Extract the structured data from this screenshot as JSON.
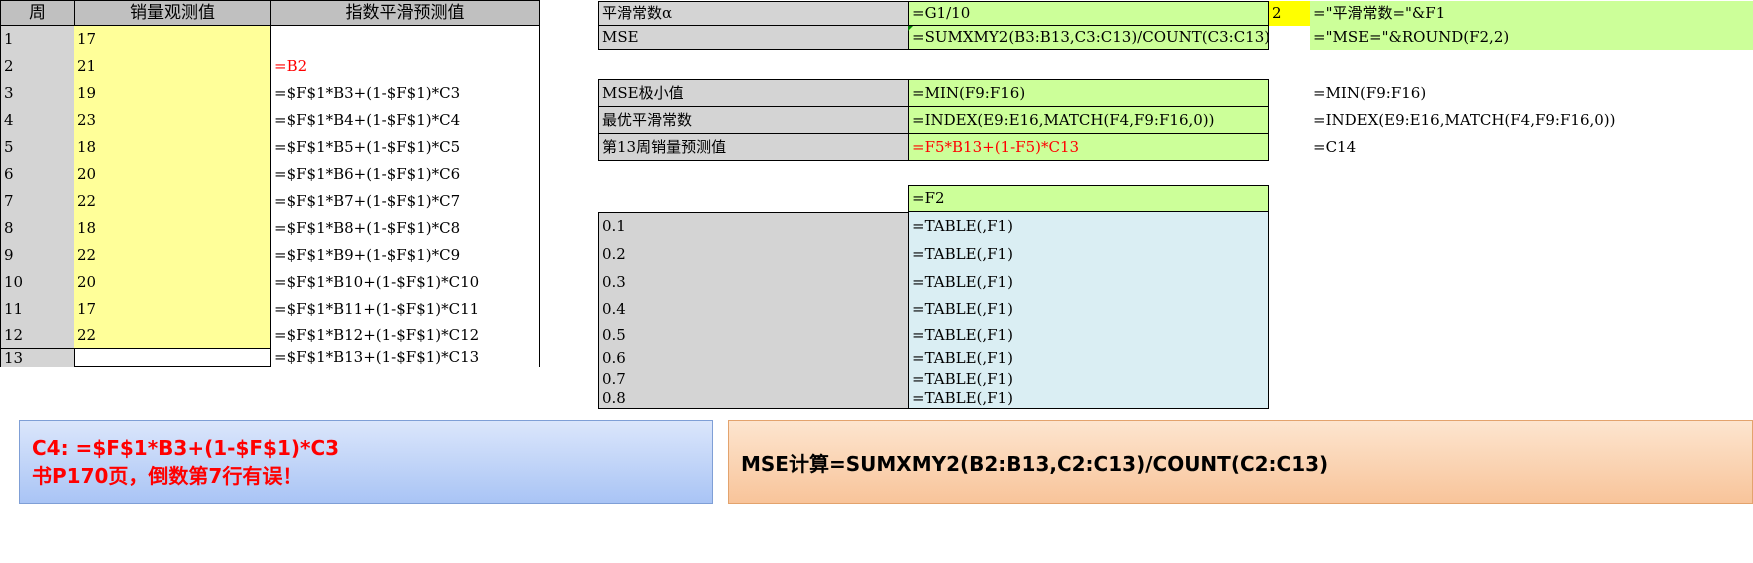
{
  "headers": {
    "week": "周",
    "observed": "销量观测值",
    "forecast": "指数平滑预测值"
  },
  "rows": [
    {
      "week": "1",
      "obs": "17",
      "fc": ""
    },
    {
      "week": "2",
      "obs": "21",
      "fc": "=B2"
    },
    {
      "week": "3",
      "obs": "19",
      "fc": "=$F$1*B3+(1-$F$1)*C3"
    },
    {
      "week": "4",
      "obs": "23",
      "fc": "=$F$1*B4+(1-$F$1)*C4"
    },
    {
      "week": "5",
      "obs": "18",
      "fc": "=$F$1*B5+(1-$F$1)*C5"
    },
    {
      "week": "6",
      "obs": "20",
      "fc": "=$F$1*B6+(1-$F$1)*C6"
    },
    {
      "week": "7",
      "obs": "22",
      "fc": "=$F$1*B7+(1-$F$1)*C7"
    },
    {
      "week": "8",
      "obs": "18",
      "fc": "=$F$1*B8+(1-$F$1)*C8"
    },
    {
      "week": "9",
      "obs": "22",
      "fc": "=$F$1*B9+(1-$F$1)*C9"
    },
    {
      "week": "10",
      "obs": "20",
      "fc": "=$F$1*B10+(1-$F$1)*C10"
    },
    {
      "week": "11",
      "obs": "17",
      "fc": "=$F$1*B11+(1-$F$1)*C11"
    },
    {
      "week": "12",
      "obs": "22",
      "fc": "=$F$1*B12+(1-$F$1)*C12"
    },
    {
      "week": "13",
      "obs": "",
      "fc": "=$F$1*B13+(1-$F$1)*C13"
    }
  ],
  "params": {
    "alpha_label": "平滑常数α",
    "alpha_formula": "=G1/10",
    "spinner_value": "2",
    "alpha_text": "=\"平滑常数=\"&F1",
    "mse_label": "MSE",
    "mse_formula": "=SUMXMY2(B3:B13,C3:C13)/COUNT(C3:C13)",
    "mse_text": "=\"MSE=\"&ROUND(F2,2)"
  },
  "results": [
    {
      "label": "MSE极小值",
      "formula": "=MIN(F9:F16)",
      "note": "=MIN(F9:F16)"
    },
    {
      "label": "最优平滑常数",
      "formula": "=INDEX(E9:E16,MATCH(F4,F9:F16,0))",
      "note": "=INDEX(E9:E16,MATCH(F4,F9:F16,0))"
    },
    {
      "label": "第13周销量预测值",
      "formula": "=F5*B13+(1-F5)*C13",
      "note": "=C14"
    }
  ],
  "table": {
    "head_formula": "=F2",
    "rows": [
      {
        "alpha": "0.1",
        "formula": "=TABLE(,F1)"
      },
      {
        "alpha": "0.2",
        "formula": "=TABLE(,F1)"
      },
      {
        "alpha": "0.3",
        "formula": "=TABLE(,F1)"
      },
      {
        "alpha": "0.4",
        "formula": "=TABLE(,F1)"
      },
      {
        "alpha": "0.5",
        "formula": "=TABLE(,F1)"
      },
      {
        "alpha": "0.6",
        "formula": "=TABLE(,F1)"
      },
      {
        "alpha": "0.7",
        "formula": "=TABLE(,F1)"
      },
      {
        "alpha": "0.8",
        "formula": "=TABLE(,F1)"
      }
    ]
  },
  "notes": {
    "c4_line": "C4:   =$F$1*B3+(1-$F$1)*C3",
    "errata_line": "书P170页，倒数第7行有误！",
    "mse_line": "MSE计算=SUMXMY2(B2:B13,C2:C13)/COUNT(C2:C13)"
  },
  "colors": {
    "accent_red": "#ff0000",
    "input_yellow": "#ffff99",
    "formula_green": "#ccff99",
    "table_blue": "#daeef3"
  }
}
